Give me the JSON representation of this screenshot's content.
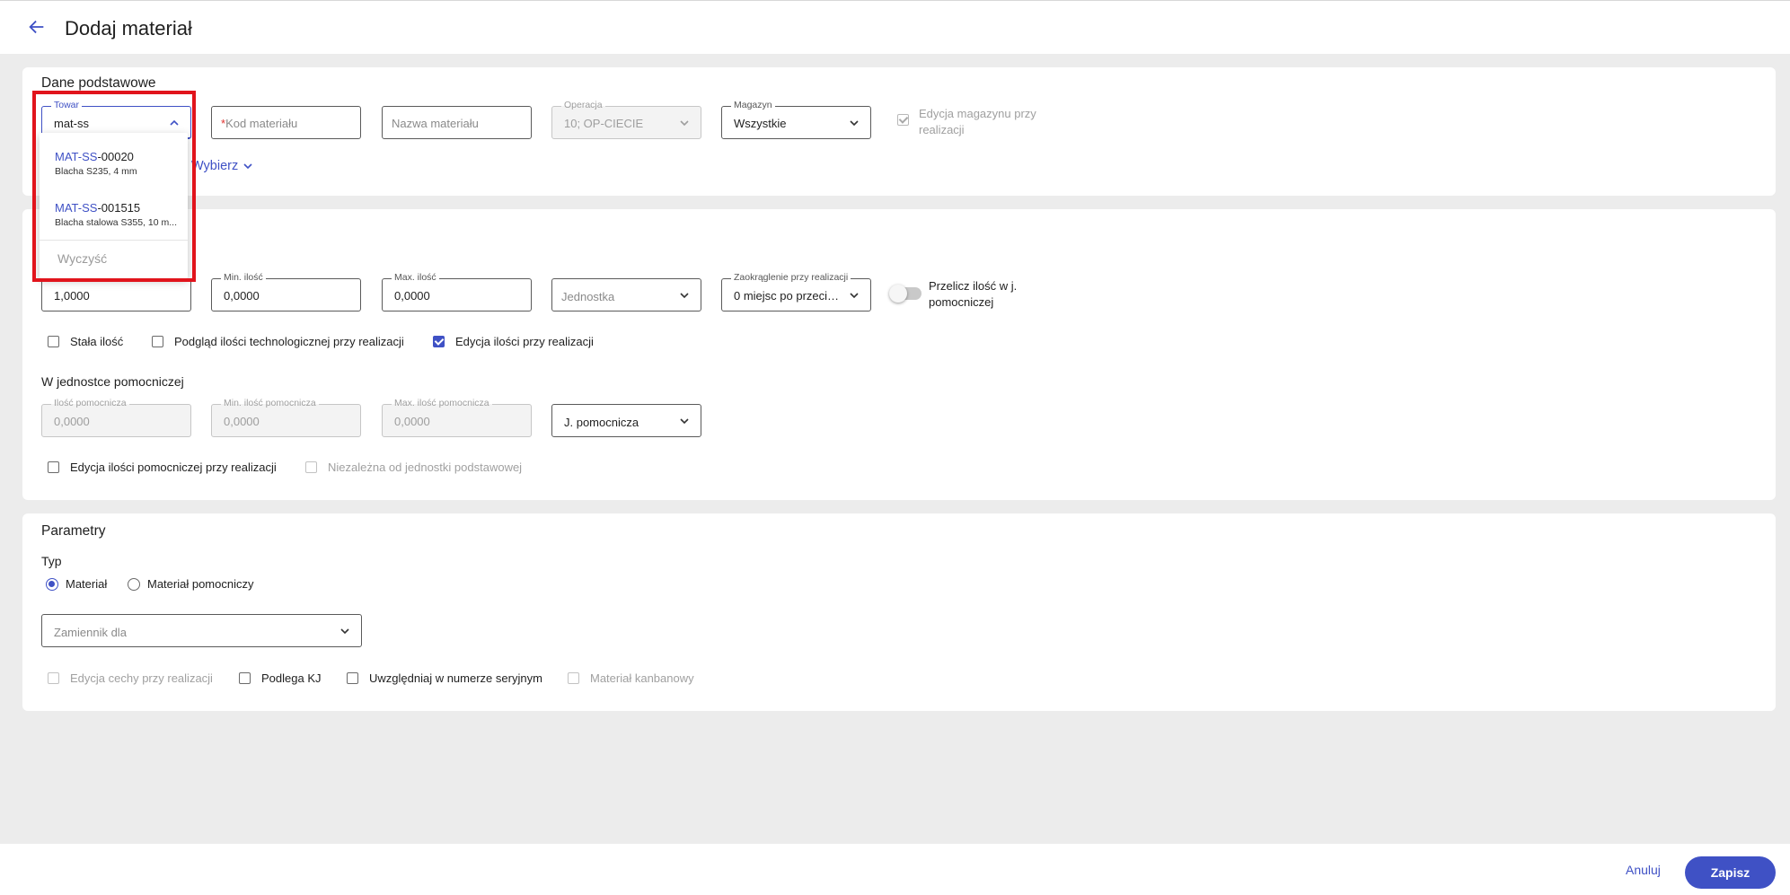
{
  "header": {
    "title": "Dodaj materiał"
  },
  "basic": {
    "section_title": "Dane podstawowe",
    "towar": {
      "label": "Towar",
      "value": "mat-ss"
    },
    "kod": {
      "required_mark": "*",
      "placeholder": "Kod materiału"
    },
    "nazwa": {
      "placeholder": "Nazwa materiału"
    },
    "operacja": {
      "label": "Operacja",
      "value": "10; OP-CIECIE"
    },
    "magazyn": {
      "label": "Magazyn",
      "value": "Wszystkie"
    },
    "edycja_magazynu": {
      "label": "Edycja magazynu przy realizacji",
      "checked": true
    },
    "choose_link": "Wybierz"
  },
  "dropdown": {
    "items": [
      {
        "code_match": "MAT-SS",
        "code_rest": "-00020",
        "desc": "Blacha S235, 4 mm"
      },
      {
        "code_match": "MAT-SS",
        "code_rest": "-001515",
        "desc": "Blacha stalowa S355, 10 m..."
      }
    ],
    "clear_label": "Wyczyść"
  },
  "quantity": {
    "ilosc": {
      "value": "1,0000"
    },
    "min": {
      "label": "Min. ilość",
      "value": "0,0000"
    },
    "max": {
      "label": "Max. ilość",
      "value": "0,0000"
    },
    "jednostka": {
      "placeholder": "Jednostka"
    },
    "zaokraglenie": {
      "label": "Zaokrąglenie przy realizacji",
      "value": "0 miejsc po przecin..."
    },
    "przelicz": {
      "label": "Przelicz ilość w j. pomocniczej",
      "on": false
    },
    "checkboxes": [
      {
        "label": "Stała ilość",
        "checked": false
      },
      {
        "label": "Podgląd ilości technologicznej przy realizacji",
        "checked": false
      },
      {
        "label": "Edycja ilości przy realizacji",
        "checked": true
      }
    ]
  },
  "aux": {
    "section_title": "W jednostce pomocniczej",
    "ilosc": {
      "label": "Ilość pomocnicza",
      "value": "0,0000"
    },
    "min": {
      "label": "Min. ilość pomocnicza",
      "value": "0,0000"
    },
    "max": {
      "label": "Max. ilość pomocnicza",
      "value": "0,0000"
    },
    "jednostka": {
      "placeholder": "J. pomocnicza"
    },
    "edycja": {
      "label": "Edycja ilości pomocniczej przy realizacji",
      "checked": false
    },
    "niezalezna": {
      "label": "Niezależna od jednostki podstawowej",
      "checked": false
    }
  },
  "params": {
    "section_title": "Parametry",
    "typ_label": "Typ",
    "radios": [
      {
        "label": "Materiał",
        "checked": true
      },
      {
        "label": "Materiał pomocniczy",
        "checked": false
      }
    ],
    "zamiennik": {
      "placeholder": "Zamiennik dla"
    },
    "checkboxes": [
      {
        "label": "Edycja cechy przy realizacji",
        "checked": false,
        "disabled": true
      },
      {
        "label": "Podlega KJ",
        "checked": false,
        "disabled": false
      },
      {
        "label": "Uwzględniaj w numerze seryjnym",
        "checked": false,
        "disabled": false
      },
      {
        "label": "Materiał kanbanowy",
        "checked": false,
        "disabled": true
      }
    ]
  },
  "footer": {
    "cancel_label": "Anuluj",
    "save_label": "Zapisz"
  },
  "colors": {
    "accent": "#3f51c5",
    "highlight_frame": "#e1141c",
    "background": "#ececec"
  }
}
